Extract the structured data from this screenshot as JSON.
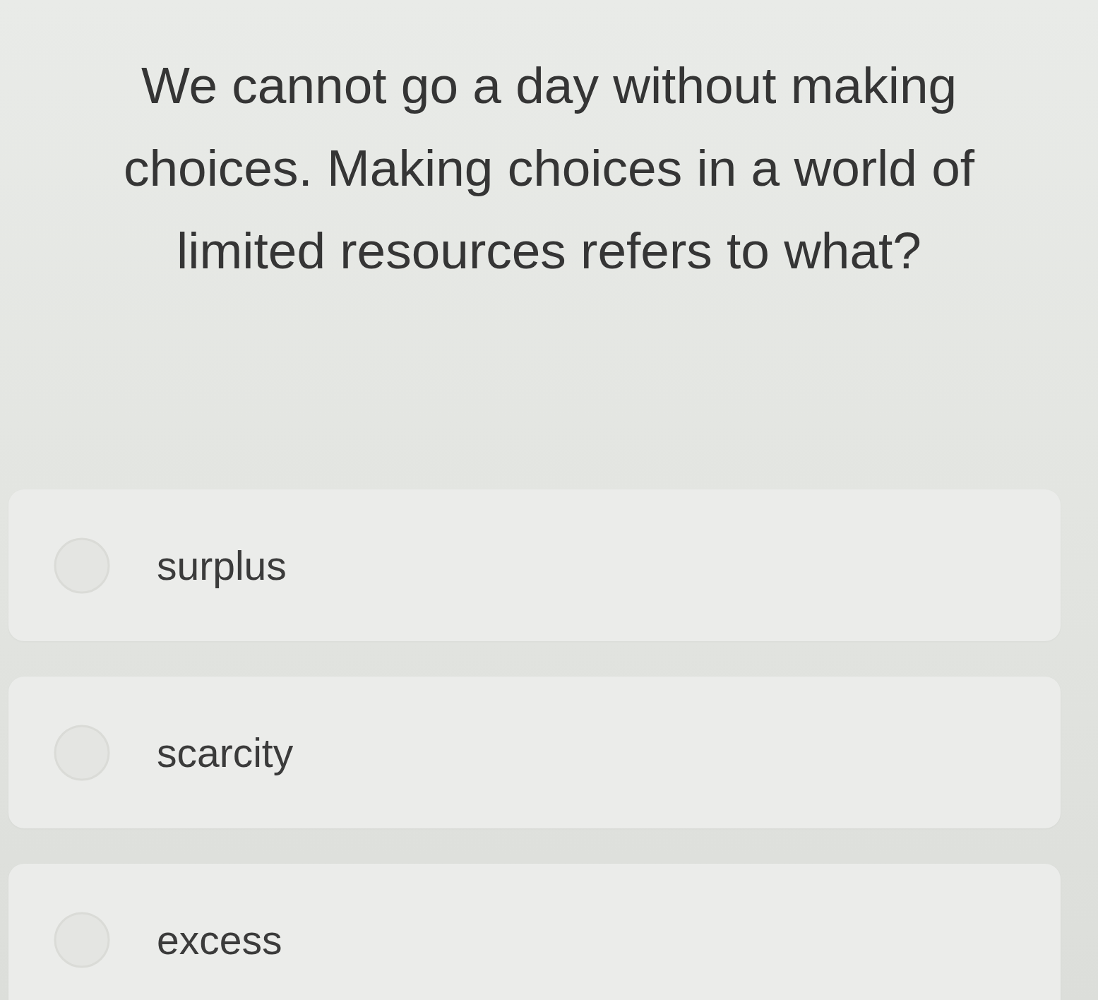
{
  "question": {
    "text": "We cannot go a day without making choices. Making choices in a world of limited resources refers to what?"
  },
  "options": [
    {
      "label": "surplus",
      "selected": false
    },
    {
      "label": "scarcity",
      "selected": false
    },
    {
      "label": "excess",
      "selected": false
    }
  ]
}
